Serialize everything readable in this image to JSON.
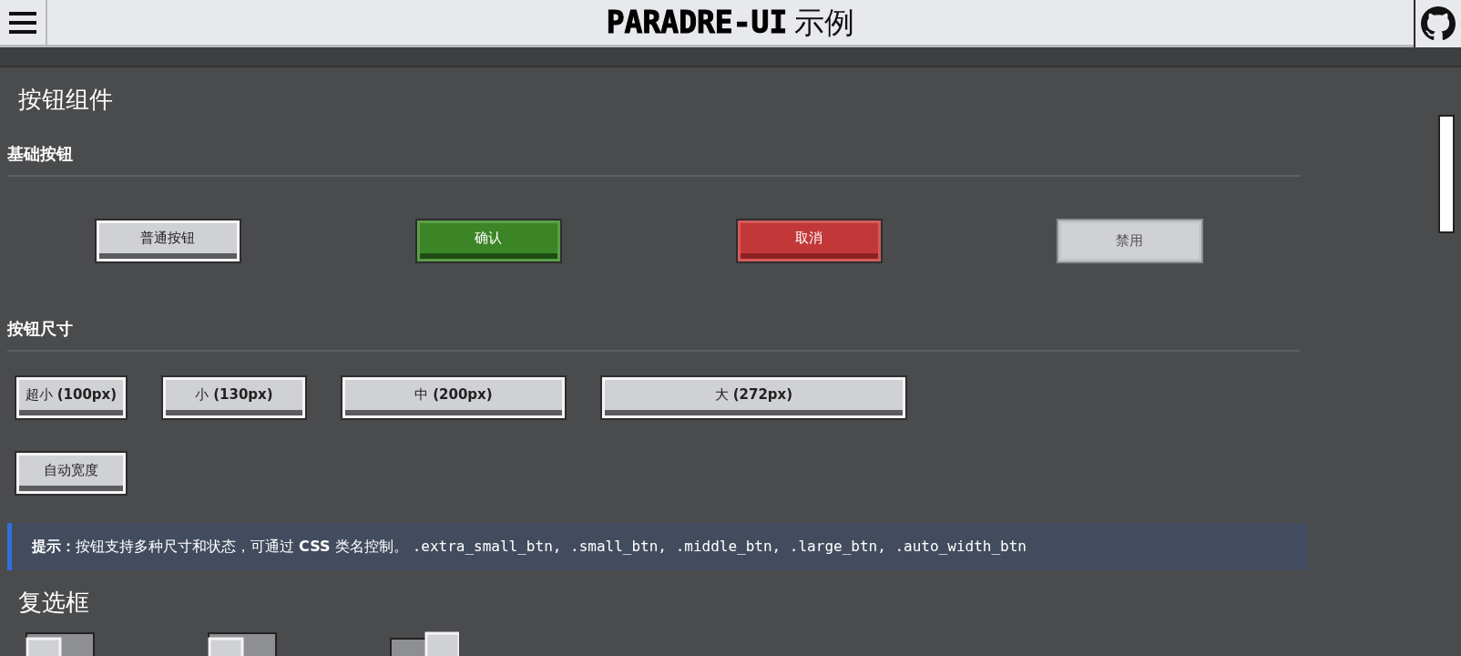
{
  "header": {
    "title": "PARADRE-UI",
    "subtitle": "示例"
  },
  "sections": [
    {
      "title": "按钮组件",
      "groups": [
        {
          "title": "基础按钮",
          "kind": "spread",
          "buttons": [
            {
              "label": "普通按钮",
              "kind": "default",
              "disabled": false
            },
            {
              "label": "确认",
              "kind": "primary",
              "disabled": false
            },
            {
              "label": "取消",
              "kind": "danger",
              "disabled": false
            },
            {
              "label": "禁用",
              "kind": "default",
              "disabled": true
            }
          ]
        },
        {
          "title": "按钮尺寸",
          "kind": "sizes",
          "buttons": [
            {
              "label": "超小 **(100px)**",
              "kind": "xs",
              "disabled": false
            },
            {
              "label": "小 **(130px)**",
              "kind": "sm",
              "disabled": false
            },
            {
              "label": "中 **(200px)**",
              "kind": "md",
              "disabled": false
            },
            {
              "label": "大 **(272px)**",
              "kind": "lg",
              "disabled": false
            },
            {
              "label": "自动宽度",
              "kind": "auto",
              "disabled": false
            }
          ]
        }
      ],
      "tip": {
        "text": "**提示：**按钮支持多种尺寸和状态，可通过 **CSS** 类名控制。",
        "code": ".extra_small_btn, .small_btn, .middle_btn, .large_btn, .auto_width_btn"
      }
    },
    {
      "title": "复选框",
      "checkboxes": [
        {
          "checked": false
        },
        {
          "checked": false
        },
        {
          "checked": true
        }
      ]
    }
  ]
}
